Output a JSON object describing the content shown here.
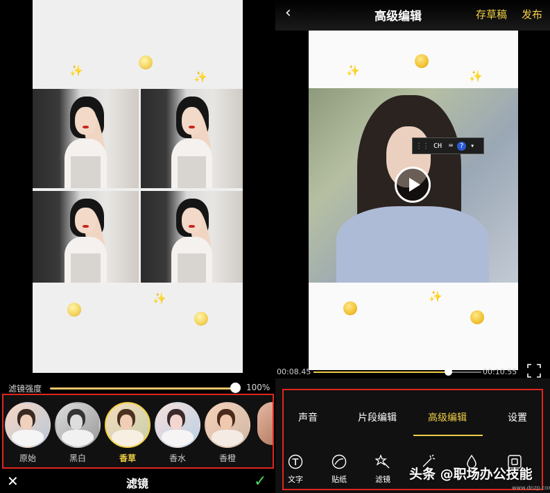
{
  "left_panel": {
    "intensity_label": "滤镜强度",
    "intensity_value": "100%",
    "intensity_level": 1.0,
    "filters": [
      {
        "label": "原始",
        "selected": false
      },
      {
        "label": "黑白",
        "selected": false
      },
      {
        "label": "香草",
        "selected": true
      },
      {
        "label": "香水",
        "selected": false
      },
      {
        "label": "香橙",
        "selected": false
      }
    ],
    "bottom_title": "滤镜",
    "close_icon": "close-icon",
    "confirm_icon": "check-icon"
  },
  "right_panel": {
    "title": "高级编辑",
    "save_draft": "存草稿",
    "publish": "发布",
    "ime": {
      "text": "CH"
    },
    "time_current": "00:08.45",
    "time_total": "00:10.55",
    "progress": 0.8,
    "tabs": [
      {
        "label": "声音",
        "active": false
      },
      {
        "label": "片段编辑",
        "active": false
      },
      {
        "label": "高级编辑",
        "active": true
      },
      {
        "label": "设置",
        "active": false
      }
    ],
    "tools": [
      {
        "label": "文字",
        "icon": "text-icon"
      },
      {
        "label": "贴纸",
        "icon": "sticker-icon"
      },
      {
        "label": "滤镜",
        "icon": "filter-icon"
      },
      {
        "label": "",
        "icon": "magic-icon"
      },
      {
        "label": "",
        "icon": "ink-icon"
      },
      {
        "label": "",
        "icon": "frame-icon"
      }
    ],
    "watermark": "头条 @职场办公技能",
    "watermark_url": "www.dnzp.com"
  },
  "colors": {
    "accent": "#f3d046",
    "highlight_border": "#e0261f",
    "confirm": "#4cd964"
  }
}
